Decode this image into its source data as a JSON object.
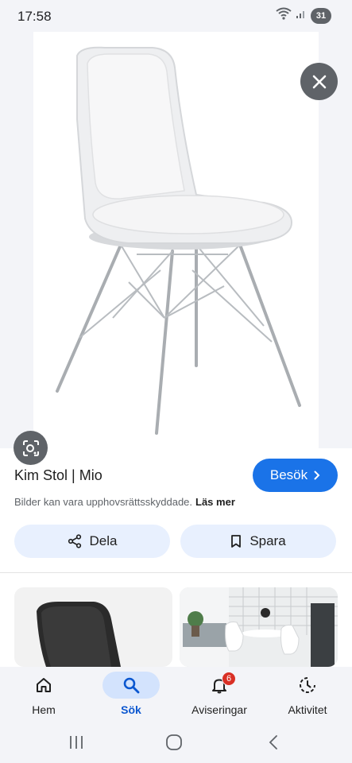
{
  "status_bar": {
    "time": "17:58",
    "battery": "31"
  },
  "result": {
    "title": "Kim Stol | Mio",
    "visit_label": "Besök",
    "copyright_text": "Bilder kan vara upphovsrättsskyddade.",
    "learn_more": "Läs mer",
    "share_label": "Dela",
    "save_label": "Spara"
  },
  "bottom_nav": {
    "items": [
      {
        "label": "Hem",
        "icon": "home-icon"
      },
      {
        "label": "Sök",
        "icon": "search-icon",
        "active": true
      },
      {
        "label": "Aviseringar",
        "icon": "bell-icon",
        "badge": "6"
      },
      {
        "label": "Aktivitet",
        "icon": "activity-icon"
      }
    ]
  },
  "colors": {
    "accent": "#1a73e8",
    "pill_bg": "#e8f0fe",
    "badge": "#d93025",
    "chrome_bg": "#f3f4f8"
  }
}
